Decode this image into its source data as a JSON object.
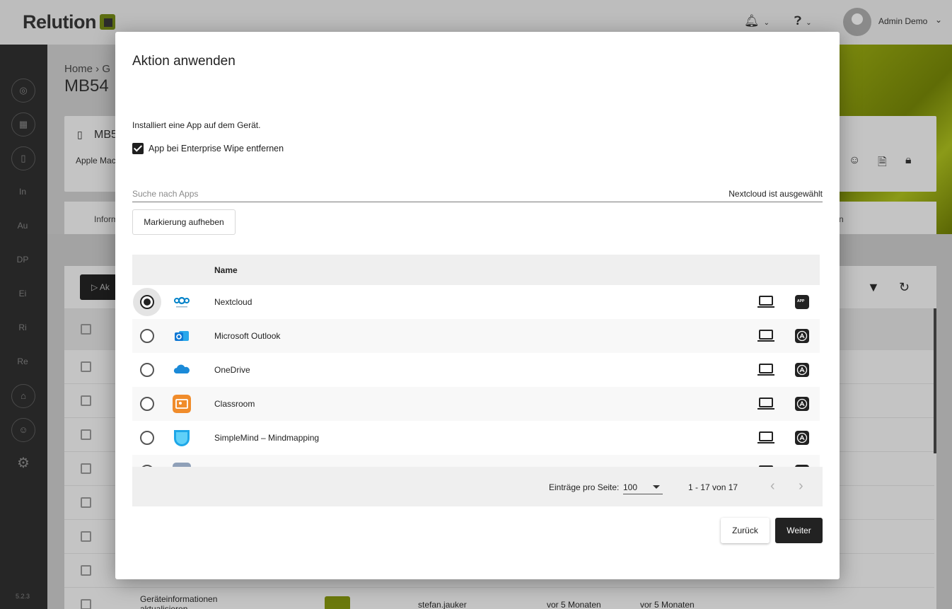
{
  "app": {
    "brand": "Relution",
    "user_name": "Admin Demo",
    "bell_icon": "bell-icon",
    "help_icon": "question-circle-icon",
    "version": "5.2.3"
  },
  "sidebar": {
    "items": [
      {
        "icon": "dashboard-icon"
      },
      {
        "icon": "apps-grid-icon"
      },
      {
        "icon": "device-icon"
      },
      {
        "label": "In"
      },
      {
        "label": "Au"
      },
      {
        "label": "DP"
      },
      {
        "label": "Ei"
      },
      {
        "label": "Ri"
      },
      {
        "label": "Re"
      },
      {
        "icon": "education-icon"
      },
      {
        "icon": "user-icon"
      },
      {
        "icon": "gear-icon"
      }
    ]
  },
  "background": {
    "breadcrumb": "Home  ›  G",
    "page_title": "MB54",
    "device_name": "MB5",
    "device_type": "Apple Mac",
    "tab_left": "Inform",
    "tab_right": "n",
    "action_button": "Ak",
    "last_row": {
      "action": "Geräteinformationen aktualisieren",
      "user": "stefan.jauker",
      "created": "vor 5 Monaten",
      "updated": "vor 5 Monaten"
    }
  },
  "modal": {
    "title": "Aktion anwenden",
    "description": "Installiert eine App auf dem Gerät.",
    "checkbox_label": "App bei Enterprise Wipe entfernen",
    "checkbox_checked": true,
    "search_placeholder": "Suche nach Apps",
    "search_value": "",
    "selected_text": "Nextcloud ist ausgewählt",
    "clear_button": "Markierung aufheben",
    "column_name": "Name",
    "apps": [
      {
        "name": "Nextcloud",
        "selected": true,
        "icon": "nextcloud-icon",
        "color": "#0082c9",
        "platform": "laptop-icon",
        "store": "app-badge-icon"
      },
      {
        "name": "Microsoft Outlook",
        "selected": false,
        "icon": "outlook-icon",
        "color": "#0f78d4",
        "platform": "laptop-icon",
        "store": "app-store-icon"
      },
      {
        "name": "OneDrive",
        "selected": false,
        "icon": "onedrive-icon",
        "color": "#1b8ad8",
        "platform": "laptop-icon",
        "store": "app-store-icon"
      },
      {
        "name": "Classroom",
        "selected": false,
        "icon": "classroom-icon",
        "color": "#f08c2b",
        "platform": "laptop-icon",
        "store": "app-store-icon"
      },
      {
        "name": "SimpleMind – Mindmapping",
        "selected": false,
        "icon": "simplemind-icon",
        "color": "#1ea7e8",
        "platform": "laptop-icon",
        "store": "app-store-icon"
      }
    ],
    "pagination": {
      "per_page_label": "Einträge pro Seite:",
      "per_page_value": "100",
      "range": "1 - 17 von 17"
    },
    "back_button": "Zurück",
    "next_button": "Weiter"
  }
}
